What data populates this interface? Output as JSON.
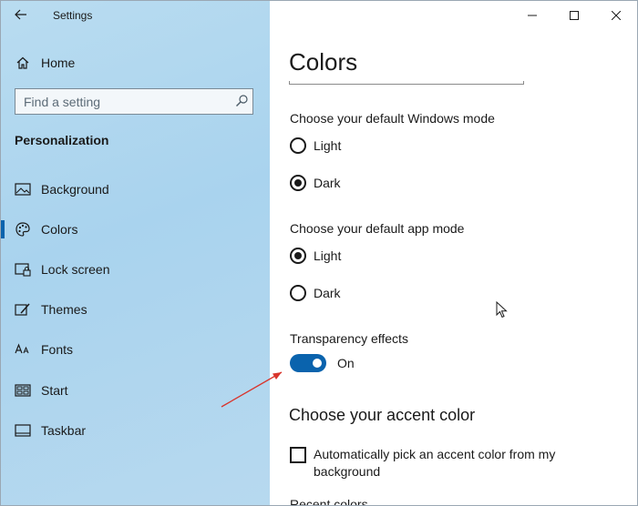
{
  "window": {
    "title": "Settings"
  },
  "sidebar": {
    "home_label": "Home",
    "search_placeholder": "Find a setting",
    "section_heading": "Personalization",
    "items": [
      {
        "label": "Background",
        "icon": "picture-icon"
      },
      {
        "label": "Colors",
        "icon": "palette-icon",
        "selected": true
      },
      {
        "label": "Lock screen",
        "icon": "lock-screen-icon"
      },
      {
        "label": "Themes",
        "icon": "themes-icon"
      },
      {
        "label": "Fonts",
        "icon": "fonts-icon"
      },
      {
        "label": "Start",
        "icon": "start-icon"
      },
      {
        "label": "Taskbar",
        "icon": "taskbar-icon"
      }
    ]
  },
  "content": {
    "title": "Colors",
    "windows_mode": {
      "label": "Choose your default Windows mode",
      "options": [
        {
          "label": "Light",
          "checked": false
        },
        {
          "label": "Dark",
          "checked": true
        }
      ]
    },
    "app_mode": {
      "label": "Choose your default app mode",
      "options": [
        {
          "label": "Light",
          "checked": true
        },
        {
          "label": "Dark",
          "checked": false
        }
      ]
    },
    "transparency": {
      "label": "Transparency effects",
      "state": "On",
      "on": true
    },
    "accent": {
      "heading": "Choose your accent color",
      "auto_pick_label": "Automatically pick an accent color from my background",
      "recent_label": "Recent colors"
    }
  },
  "colors": {
    "accent": "#0a63ad",
    "sidebar_bg": "#aed5ee",
    "annotation": "#d9342b"
  }
}
